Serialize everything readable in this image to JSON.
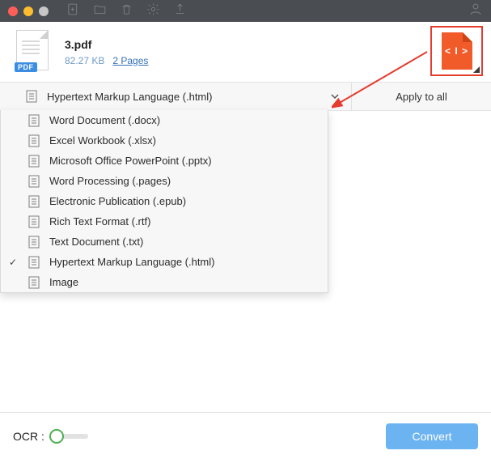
{
  "file": {
    "name": "3.pdf",
    "size": "82.27 KB",
    "pages": "2 Pages",
    "badge": "PDF"
  },
  "format_select": {
    "selected_label": "Hypertext Markup Language (.html)",
    "apply_all_label": "Apply to all",
    "options": [
      {
        "label": "Word Document (.docx)",
        "selected": false
      },
      {
        "label": "Excel Workbook (.xlsx)",
        "selected": false
      },
      {
        "label": "Microsoft Office PowerPoint (.pptx)",
        "selected": false
      },
      {
        "label": "Word Processing (.pages)",
        "selected": false
      },
      {
        "label": "Electronic Publication (.epub)",
        "selected": false
      },
      {
        "label": "Rich Text Format (.rtf)",
        "selected": false
      },
      {
        "label": "Text Document (.txt)",
        "selected": false
      },
      {
        "label": "Hypertext Markup Language (.html)",
        "selected": true
      },
      {
        "label": "Image",
        "selected": false
      }
    ]
  },
  "footer": {
    "ocr_label": "OCR :",
    "convert_label": "Convert"
  },
  "output_preview": {
    "glyph": "< I >"
  }
}
